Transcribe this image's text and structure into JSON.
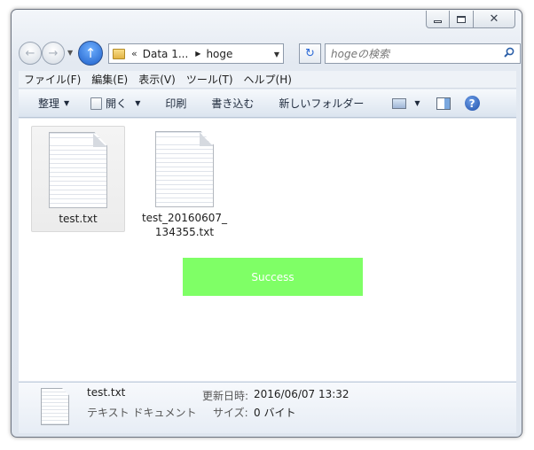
{
  "window": {
    "caption_buttons": {
      "close_glyph": "✕"
    }
  },
  "navigation": {
    "back_icon": "back-arrow-icon",
    "forward_icon": "forward-arrow-icon",
    "up_icon": "up-arrow-icon",
    "address": {
      "overflow_chevron": "«",
      "segments": [
        "Data 1...",
        "hoge"
      ]
    },
    "search": {
      "placeholder": "hogeの検索"
    }
  },
  "menubar": {
    "items": [
      "ファイル(F)",
      "編集(E)",
      "表示(V)",
      "ツール(T)",
      "ヘルプ(H)"
    ]
  },
  "toolbar": {
    "organize": "整理",
    "open": "開く",
    "print": "印刷",
    "burn": "書き込む",
    "new_folder": "新しいフォルダー"
  },
  "files": [
    {
      "name": "test.txt",
      "selected": true
    },
    {
      "name_line1": "test_20160607_",
      "name_line2": "134355.txt",
      "selected": false
    }
  ],
  "overlay": {
    "message": "Success",
    "color": "#7fff66"
  },
  "details": {
    "name": "test.txt",
    "type": "テキスト ドキュメント",
    "modified_label": "更新日時:",
    "modified_value": "2016/06/07 13:32",
    "size_label": "サイズ:",
    "size_value": "0 バイト"
  }
}
